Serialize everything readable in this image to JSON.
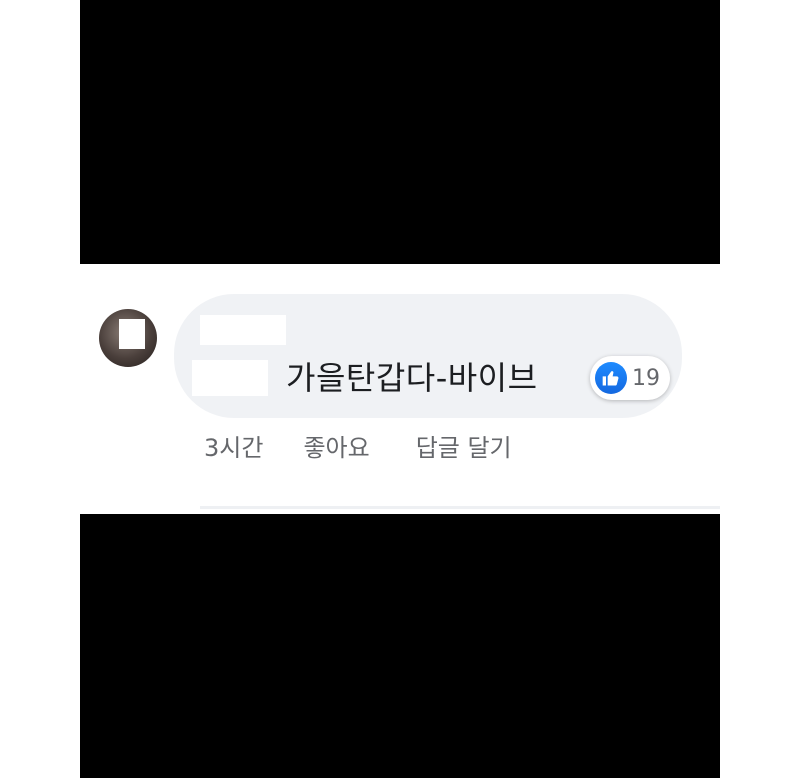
{
  "comment": {
    "text": "가을탄갑다-바이브",
    "like_count": "19",
    "timestamp": "3시간",
    "like_label": "좋아요",
    "reply_label": "답글 달기"
  },
  "icons": {
    "reaction": "thumbs-up-icon"
  },
  "colors": {
    "bubble": "#f0f2f5",
    "like_blue": "#1877f2",
    "secondary_text": "#65676b",
    "censor_bar": "#000000"
  }
}
